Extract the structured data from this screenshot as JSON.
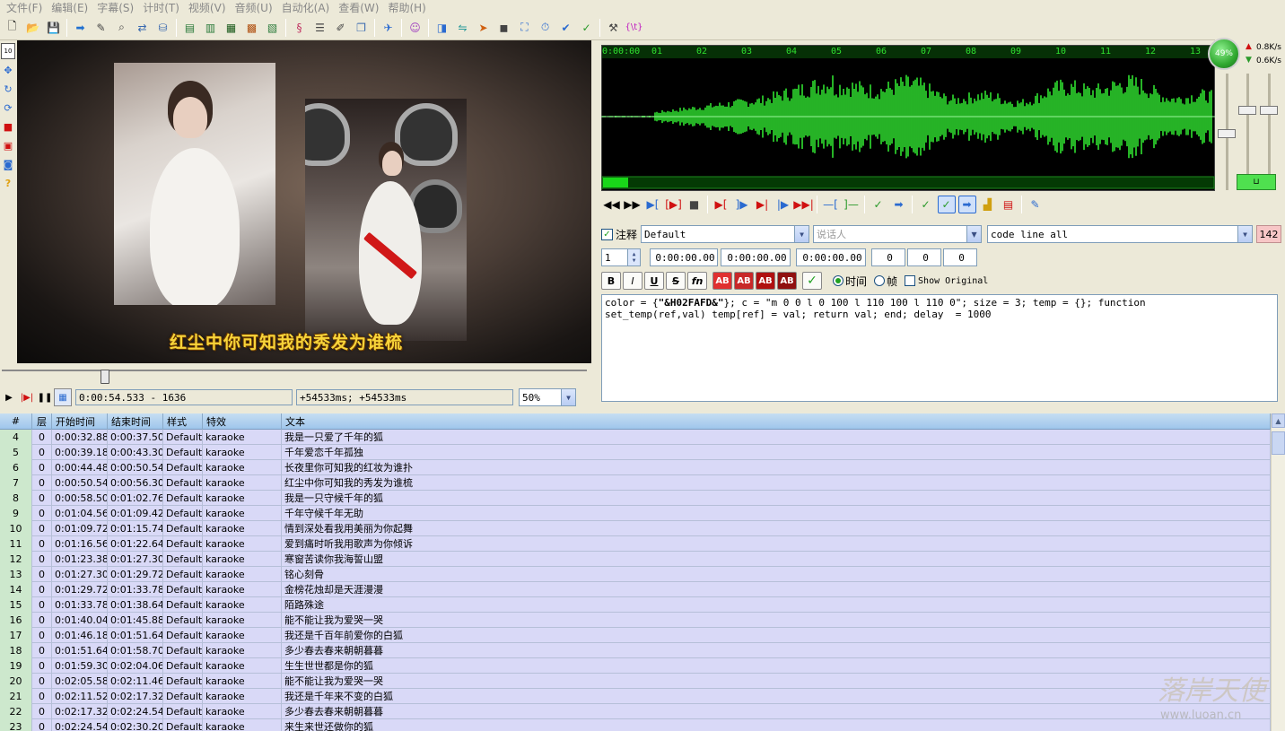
{
  "menu": [
    "文件(F)",
    "编辑(E)",
    "字幕(S)",
    "计时(T)",
    "视频(V)",
    "音频(U)",
    "自动化(A)",
    "查看(W)",
    "帮助(H)"
  ],
  "video": {
    "karaoke_text": "红尘中你可知我的秀发为谁梳",
    "time_display": "0:00:54.533 - 1636",
    "offset_display": "+54533ms; +54533ms",
    "zoom": "50%"
  },
  "audio": {
    "ruler_ticks": [
      "0:00:00",
      "01",
      "02",
      "03",
      "04",
      "05",
      "06",
      "07",
      "08",
      "09",
      "10",
      "11",
      "12",
      "13"
    ],
    "gauge_percent": "49%",
    "net_up": "0.8K/s",
    "net_down": "0.6K/s",
    "wave_color": "#2fe02f"
  },
  "editor": {
    "comment_label": "注释",
    "comment_checked": true,
    "style": "Default",
    "actor_placeholder": "说话人",
    "effect": "code line all",
    "char_count": "142",
    "layer": "1",
    "start_time": "0:00:00.00",
    "end_time": "0:00:00.00",
    "duration": "0:00:00.00",
    "margin_l": "0",
    "margin_r": "0",
    "margin_v": "0",
    "fmt_bold": "B",
    "fmt_italic": "I",
    "fmt_underline": "U",
    "fmt_strike": "S",
    "fmt_fn": "fn",
    "ab_label": "AB",
    "time_radio": "时间",
    "frame_radio": "帧",
    "show_original": "Show Original",
    "text_line1_a": "color = {",
    "text_line1_b": "\"&H02FAFD&\"",
    "text_line1_c": "}; c = \"m 0 0 l 0 100 l 110 100 l 110 0\"; size = 3; temp = {}; function",
    "text_line2": "set_temp(ref,val) temp[ref] = val; return val; end; delay  = 1000"
  },
  "grid": {
    "headers": [
      "#",
      "层",
      "开始时间",
      "结束时间",
      "样式",
      "特效",
      "文本"
    ],
    "rows": [
      [
        "4",
        "0",
        "0:00:32.88",
        "0:00:37.50",
        "Default",
        "karaoke",
        "我是一只爱了千年的狐"
      ],
      [
        "5",
        "0",
        "0:00:39.18",
        "0:00:43.30",
        "Default",
        "karaoke",
        "千年爱恋千年孤独"
      ],
      [
        "6",
        "0",
        "0:00:44.48",
        "0:00:50.54",
        "Default",
        "karaoke",
        "长夜里你可知我的红妆为谁扑"
      ],
      [
        "7",
        "0",
        "0:00:50.54",
        "0:00:56.30",
        "Default",
        "karaoke",
        "红尘中你可知我的秀发为谁梳"
      ],
      [
        "8",
        "0",
        "0:00:58.50",
        "0:01:02.76",
        "Default",
        "karaoke",
        "我是一只守候千年的狐"
      ],
      [
        "9",
        "0",
        "0:01:04.56",
        "0:01:09.42",
        "Default",
        "karaoke",
        "千年守候千年无助"
      ],
      [
        "10",
        "0",
        "0:01:09.72",
        "0:01:15.74",
        "Default",
        "karaoke",
        "情到深处看我用美丽为你起舞"
      ],
      [
        "11",
        "0",
        "0:01:16.56",
        "0:01:22.64",
        "Default",
        "karaoke",
        "爱到痛时听我用歌声为你倾诉"
      ],
      [
        "12",
        "0",
        "0:01:23.38",
        "0:01:27.30",
        "Default",
        "karaoke",
        "寒窗苦读你我海誓山盟"
      ],
      [
        "13",
        "0",
        "0:01:27.30",
        "0:01:29.72",
        "Default",
        "karaoke",
        "铭心刻骨"
      ],
      [
        "14",
        "0",
        "0:01:29.72",
        "0:01:33.78",
        "Default",
        "karaoke",
        "金榜花烛却是天涯漫漫"
      ],
      [
        "15",
        "0",
        "0:01:33.78",
        "0:01:38.64",
        "Default",
        "karaoke",
        "陌路殊途"
      ],
      [
        "16",
        "0",
        "0:01:40.04",
        "0:01:45.88",
        "Default",
        "karaoke",
        "能不能让我为爱哭一哭"
      ],
      [
        "17",
        "0",
        "0:01:46.18",
        "0:01:51.64",
        "Default",
        "karaoke",
        "我还是千百年前爱你的白狐"
      ],
      [
        "18",
        "0",
        "0:01:51.64",
        "0:01:58.70",
        "Default",
        "karaoke",
        "多少春去春来朝朝暮暮"
      ],
      [
        "19",
        "0",
        "0:01:59.30",
        "0:02:04.06",
        "Default",
        "karaoke",
        "生生世世都是你的狐"
      ],
      [
        "20",
        "0",
        "0:02:05.58",
        "0:02:11.46",
        "Default",
        "karaoke",
        "能不能让我为爱哭一哭"
      ],
      [
        "21",
        "0",
        "0:02:11.52",
        "0:02:17.32",
        "Default",
        "karaoke",
        "我还是千年来不变的白狐"
      ],
      [
        "22",
        "0",
        "0:02:17.32",
        "0:02:24.54",
        "Default",
        "karaoke",
        "多少春去春来朝朝暮暮"
      ],
      [
        "23",
        "0",
        "0:02:24.54",
        "0:02:30.20",
        "Default",
        "karaoke",
        "来生来世还做你的狐"
      ]
    ]
  },
  "watermark": {
    "text": "落岸天使",
    "url": "www.luoan.cn"
  },
  "colors": {
    "row_bg": "#d9d9f7",
    "num_bg": "#cde8cd",
    "header_bg": "#9fc6ec",
    "char_count_bg": "#f7c6c6"
  }
}
